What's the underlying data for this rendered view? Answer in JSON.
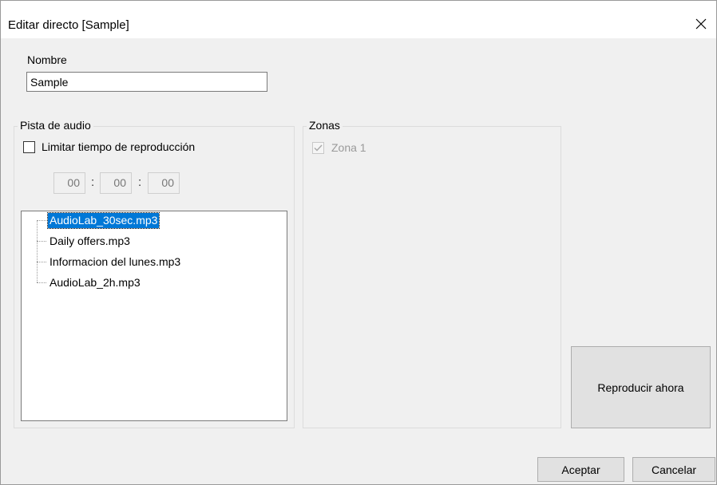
{
  "window": {
    "title": "Editar directo [Sample]",
    "close_glyph": "✕"
  },
  "name_field": {
    "label": "Nombre",
    "value": "Sample"
  },
  "audio_group": {
    "legend": "Pista de audio",
    "limit_checkbox_label": "Limitar tiempo de reproducción",
    "limit_checked": false,
    "time": {
      "hours": "00",
      "minutes": "00",
      "seconds": "00",
      "separator": ":"
    },
    "files": [
      {
        "name": "AudioLab_30sec.mp3",
        "selected": true
      },
      {
        "name": "Daily offers.mp3",
        "selected": false
      },
      {
        "name": "Informacion del lunes.mp3",
        "selected": false
      },
      {
        "name": "AudioLab_2h.mp3",
        "selected": false
      }
    ]
  },
  "zones_group": {
    "legend": "Zonas",
    "zones": [
      {
        "label": "Zona 1",
        "checked": true,
        "enabled": false
      }
    ]
  },
  "buttons": {
    "play_now": "Reproducir ahora",
    "accept": "Aceptar",
    "cancel": "Cancelar"
  },
  "colors": {
    "selection": "#0078d7",
    "dialog_bg": "#f0f0f0",
    "button_bg": "#e1e1e1"
  },
  "icons": {
    "close": "close-icon",
    "zone_check": "checkmark-icon"
  }
}
